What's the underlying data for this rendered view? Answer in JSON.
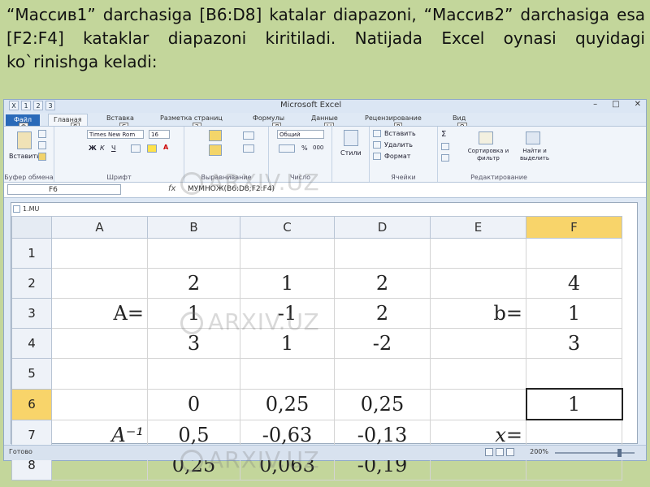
{
  "caption": "“Массив1” darchasiga [B6:D8] katalar diapazoni, “Массив2” darchasiga esa [F2:F4] kataklar diapazoni kiritiladi. Natijada Excel oynasi quyidagi ko`rinishga keladi:",
  "window": {
    "title": "Microsoft Excel",
    "controls": [
      "–",
      "□",
      "✕"
    ],
    "qat_keytips": [
      "1",
      "2",
      "3"
    ]
  },
  "tabs": {
    "file": "Файл",
    "items": [
      "Главная",
      "Вставка",
      "Разметка страниц",
      "Формулы",
      "Данные",
      "Рецензирование",
      "Вид"
    ],
    "keytips": [
      "Ф",
      "Я",
      "С",
      "З",
      "Л",
      "Ы",
      "Р",
      "О"
    ]
  },
  "ribbon": {
    "paste_label": "Вставить",
    "font_name": "Times New Rom",
    "font_size": "16",
    "number_format": "Общий",
    "styles_label": "Стили",
    "insert_label": "Вставить",
    "delete_label": "Удалить",
    "format_label": "Формат",
    "sort_label": "Сортировка и фильтр",
    "find_label": "Найти и выделить",
    "groups": [
      "Буфер обмена",
      "Шрифт",
      "Выравнивание",
      "Число",
      "Ячейки",
      "Редактирование"
    ],
    "percent": "%",
    "thousands": "000"
  },
  "formula_bar": {
    "name_box": "F6",
    "fx": "fx",
    "formula": "МУМНОЖ(B6:D8;F2:F4)"
  },
  "sheet": {
    "name": "1.MU",
    "columns": [
      "A",
      "B",
      "C",
      "D",
      "E",
      "F"
    ],
    "rows": [
      {
        "num": "1",
        "cells": [
          "",
          "",
          "",
          "",
          "",
          ""
        ]
      },
      {
        "num": "2",
        "cells": [
          "",
          "2",
          "1",
          "2",
          "",
          "4"
        ]
      },
      {
        "num": "3",
        "cells": [
          "A=",
          "1",
          "-1",
          "2",
          "b=",
          "1"
        ]
      },
      {
        "num": "4",
        "cells": [
          "",
          "3",
          "1",
          "-2",
          "",
          "3"
        ]
      },
      {
        "num": "5",
        "cells": [
          "",
          "",
          "",
          "",
          "",
          ""
        ]
      },
      {
        "num": "6",
        "cells": [
          "",
          "0",
          "0,25",
          "0,25",
          "",
          "1"
        ]
      },
      {
        "num": "7",
        "cells": [
          "A⁻¹",
          "0,5",
          "-0,63",
          "-0,13",
          "x=",
          ""
        ]
      },
      {
        "num": "8",
        "cells": [
          "",
          "0,25",
          "0,063",
          "-0,19",
          "",
          ""
        ]
      }
    ]
  },
  "status": {
    "ready": "Готово",
    "zoom": "200%"
  },
  "watermark": "ARXIV.UZ",
  "colors": {
    "background": "#c3d69b",
    "highlight": "#f8d46a",
    "file_tab": "#2a6ab9"
  }
}
